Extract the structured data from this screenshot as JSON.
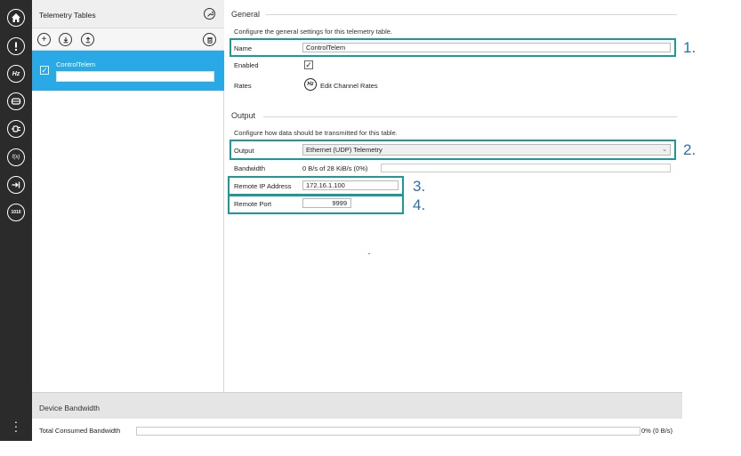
{
  "sidebar": {
    "icons": [
      {
        "name": "home-icon"
      },
      {
        "name": "alert-icon"
      },
      {
        "name": "hz-icon",
        "glyph": "Hz"
      },
      {
        "name": "tape-icon"
      },
      {
        "name": "plug-icon"
      },
      {
        "name": "function-icon",
        "glyph": "f(x)"
      },
      {
        "name": "import-icon"
      },
      {
        "name": "binary-icon",
        "glyph": "1010"
      }
    ],
    "more_icon": "vertical-ellipsis-icon"
  },
  "tables_panel": {
    "title": "Telemetry Tables",
    "settings_icon": "wrench-icon",
    "toolbar": {
      "add_icon": "add-icon",
      "download_icon": "download-icon",
      "upload_icon": "upload-icon",
      "delete_icon": "trash-icon"
    },
    "items": [
      {
        "name": "ControlTelem",
        "checked": true,
        "description": ""
      }
    ]
  },
  "general": {
    "section_title": "General",
    "hint": "Configure the general settings for this telemetry table.",
    "name_label": "Name",
    "name_value": "ControlTelem",
    "enabled_label": "Enabled",
    "enabled_checked": true,
    "rates_label": "Rates",
    "rates_link": "Edit Channel Rates"
  },
  "output": {
    "section_title": "Output",
    "hint": "Configure how data should be transmitted for this table.",
    "output_label": "Output",
    "output_value": "Ethernet (UDP) Telemetry",
    "bandwidth_label": "Bandwidth",
    "bandwidth_value": "0 B/s of 28 KiB/s (0%)",
    "remote_ip_label": "Remote IP Address",
    "remote_ip_value": "172.16.1.100",
    "remote_port_label": "Remote Port",
    "remote_port_value": "9999"
  },
  "callouts": [
    "1.",
    "2.",
    "3.",
    "4."
  ],
  "device_bandwidth": {
    "title": "Device Bandwidth",
    "label": "Total Consumed Bandwidth",
    "value": "0% (0 B/s)",
    "fraction": 0
  },
  "colors": {
    "accent": "#29a9e6",
    "highlight": "#1a9b9a",
    "callout": "#2a6fb5",
    "rail": "#2b2b2b"
  }
}
